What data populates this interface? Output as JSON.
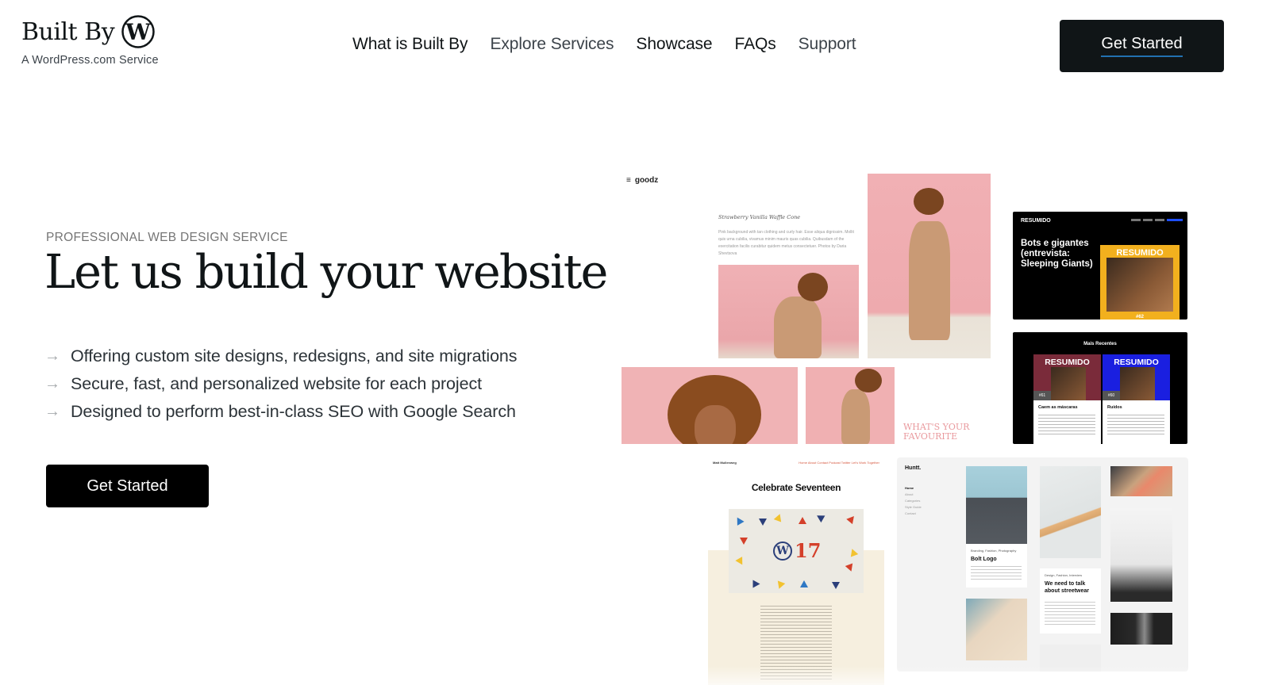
{
  "header": {
    "logo_text": "Built By",
    "logo_subtitle": "A WordPress.com Service",
    "nav": [
      {
        "label": "What is Built By"
      },
      {
        "label": "Explore Services"
      },
      {
        "label": "Showcase"
      },
      {
        "label": "FAQs"
      },
      {
        "label": "Support"
      }
    ],
    "cta_label": "Get Started"
  },
  "hero": {
    "eyebrow": "PROFESSIONAL WEB DESIGN SERVICE",
    "title": "Let us build your website",
    "features": [
      "Offering custom site designs, redesigns, and site migrations",
      "Secure, fast, and personalized website for each project",
      "Designed to perform best-in-class SEO with Google Search"
    ],
    "arrow_glyph": "→",
    "cta_label": "Get Started"
  },
  "showcase": {
    "goodz": {
      "brand": "goodz",
      "caption_title": "Strawberry Vanilla Waffle Cone",
      "caption_body": "Pink background with tan clothing and curly hair. Esse aliqua dignissim. Mollit quis urna cubilia, vivamus minim mauris quas cubilia. Quibusdam of the exercitation facilis curabitur quidem metus consectetuer. Photos by Daria Shevtsova",
      "quote": "WHAT'S YOUR FAVOURITE"
    },
    "resumido_episode": {
      "brand": "RESUMIDO",
      "episode_tag": "62",
      "title": "Bots e gigantes (entrevista: Sleeping Giants)",
      "cover_label": "RESUMIDO",
      "cover_number": "#62"
    },
    "resumido_recent": {
      "section_title": "Mais Recentes",
      "episodes": [
        {
          "label": "RESUMIDO",
          "number": "#61",
          "title": "Caem as máscaras",
          "color": "#7a2b3a"
        },
        {
          "label": "RESUMIDO",
          "number": "#60",
          "title": "Ruídos",
          "color": "#1a1fe0"
        }
      ]
    },
    "wp_blog": {
      "brand": "Matt Mullenweg",
      "nav": "Home  About  Contact  Podcast  Twitter  Let's Work Together",
      "title": "Celebrate Seventeen",
      "badge_number": "17"
    },
    "huntt": {
      "brand": "Huntt.",
      "menu": [
        "Home",
        "About",
        "Categories",
        "Style Guide",
        "Contact"
      ],
      "cards": [
        {
          "category": "Branding, Fashion, Photography",
          "title": "Bolt Logo"
        },
        {
          "category": "Design, Fashion, Interview",
          "title": "We need to talk about streetwear"
        }
      ]
    }
  },
  "colors": {
    "primary_dark": "#101517",
    "button_black": "#000000",
    "link_underline": "#2271b1",
    "muted_text": "#757575",
    "arrow": "#a7aaad"
  }
}
